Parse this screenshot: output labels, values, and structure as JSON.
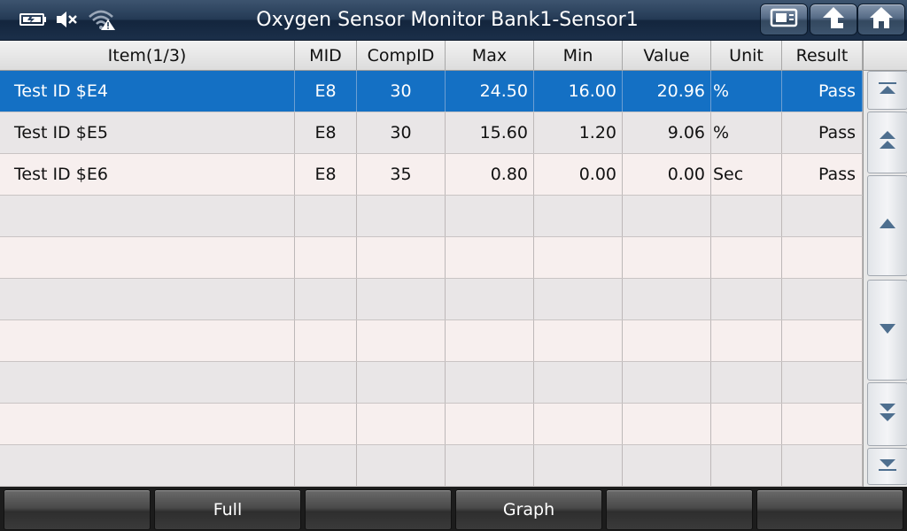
{
  "header": {
    "title": "Oxygen Sensor Monitor Bank1-Sensor1",
    "status_icons": [
      "battery-icon",
      "mute-icon",
      "wifi-warning-icon"
    ],
    "buttons": [
      {
        "name": "print-button",
        "icon": "print-icon"
      },
      {
        "name": "back-button",
        "icon": "up-arrow-icon"
      },
      {
        "name": "home-button",
        "icon": "home-icon"
      }
    ]
  },
  "table": {
    "columns": {
      "item": "Item(1/3)",
      "mid": "MID",
      "compid": "CompID",
      "max": "Max",
      "min": "Min",
      "value": "Value",
      "unit": "Unit",
      "result": "Result"
    },
    "rows": [
      {
        "item": "Test ID $E4",
        "mid": "E8",
        "compid": "30",
        "max": "24.50",
        "min": "16.00",
        "value": "20.96",
        "unit": "%",
        "result": "Pass",
        "selected": true
      },
      {
        "item": "Test ID $E5",
        "mid": "E8",
        "compid": "30",
        "max": "15.60",
        "min": "1.20",
        "value": "9.06",
        "unit": "%",
        "result": "Pass",
        "selected": false
      },
      {
        "item": "Test ID $E6",
        "mid": "E8",
        "compid": "35",
        "max": "0.80",
        "min": "0.00",
        "value": "0.00",
        "unit": "Sec",
        "result": "Pass",
        "selected": false
      },
      {
        "item": "",
        "mid": "",
        "compid": "",
        "max": "",
        "min": "",
        "value": "",
        "unit": "",
        "result": "",
        "selected": false
      },
      {
        "item": "",
        "mid": "",
        "compid": "",
        "max": "",
        "min": "",
        "value": "",
        "unit": "",
        "result": "",
        "selected": false
      },
      {
        "item": "",
        "mid": "",
        "compid": "",
        "max": "",
        "min": "",
        "value": "",
        "unit": "",
        "result": "",
        "selected": false
      },
      {
        "item": "",
        "mid": "",
        "compid": "",
        "max": "",
        "min": "",
        "value": "",
        "unit": "",
        "result": "",
        "selected": false
      },
      {
        "item": "",
        "mid": "",
        "compid": "",
        "max": "",
        "min": "",
        "value": "",
        "unit": "",
        "result": "",
        "selected": false
      },
      {
        "item": "",
        "mid": "",
        "compid": "",
        "max": "",
        "min": "",
        "value": "",
        "unit": "",
        "result": "",
        "selected": false
      },
      {
        "item": "",
        "mid": "",
        "compid": "",
        "max": "",
        "min": "",
        "value": "",
        "unit": "",
        "result": "",
        "selected": false
      }
    ]
  },
  "scrollbar": {
    "buttons": [
      "scroll-top-icon",
      "page-up-icon",
      "line-up-icon",
      "line-down-icon",
      "page-down-icon",
      "scroll-bottom-icon"
    ]
  },
  "footer": {
    "buttons": [
      "",
      "Full",
      "",
      "Graph",
      "",
      ""
    ]
  },
  "colors": {
    "selected_row": "#1470c4",
    "title_bar": "#243a55",
    "bottom_bar": "#1c1c1c"
  }
}
